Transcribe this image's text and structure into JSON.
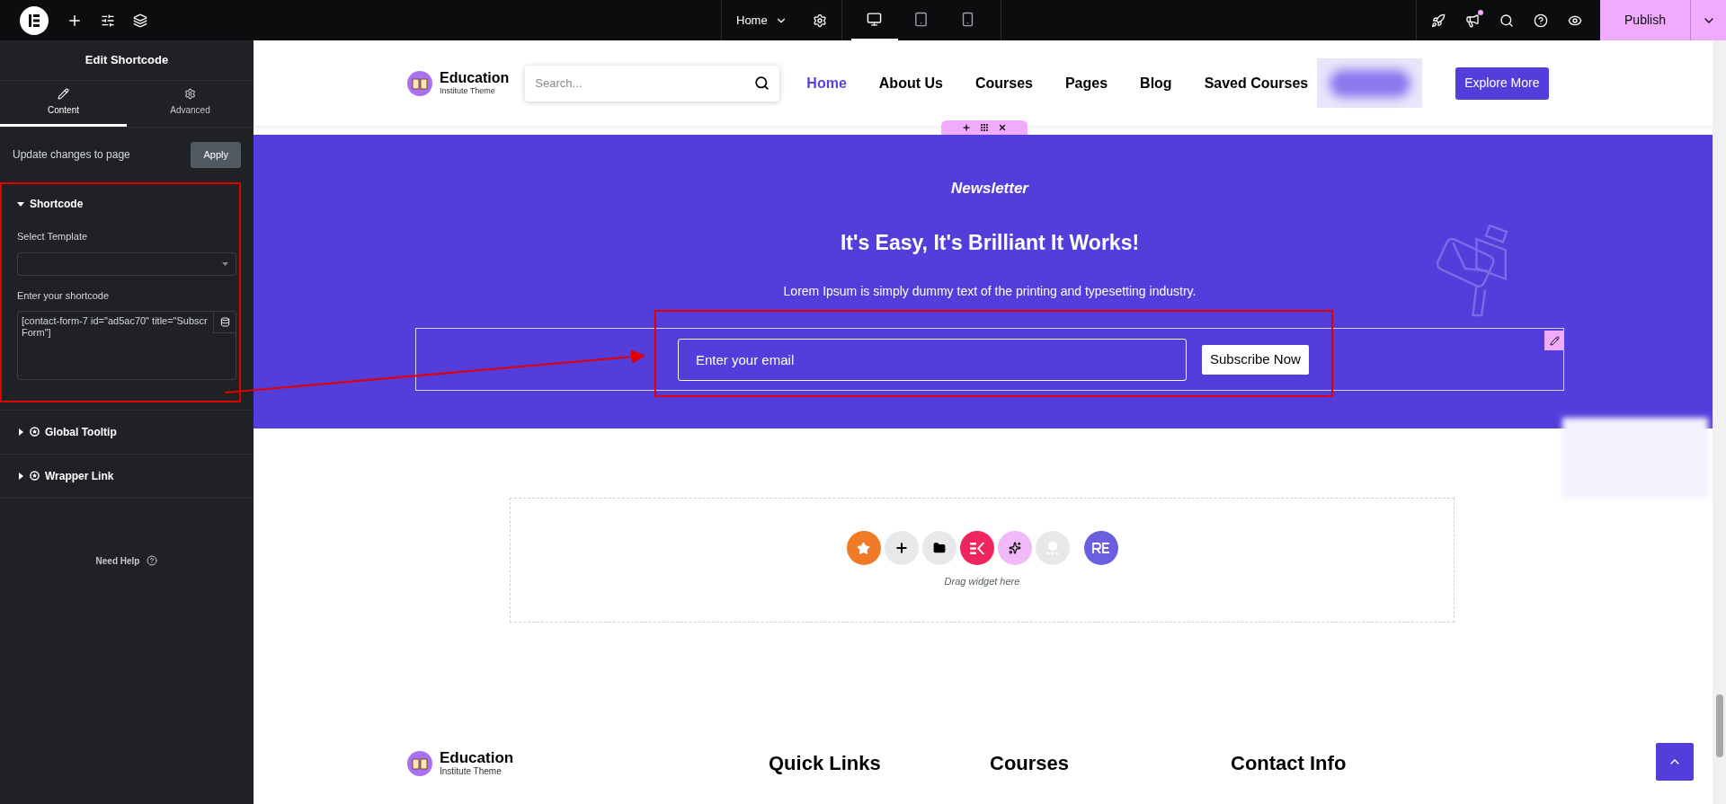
{
  "topbar": {
    "page_title": "Home",
    "devices": [
      {
        "kind": "desktop",
        "selected": true
      },
      {
        "kind": "tablet",
        "selected": false
      },
      {
        "kind": "mobile",
        "selected": false
      }
    ],
    "publish": "Publish"
  },
  "panel": {
    "title": "Edit Shortcode",
    "tabs": [
      {
        "label": "Content",
        "kind": "content",
        "selected": true
      },
      {
        "label": "Advanced",
        "kind": "advanced",
        "selected": false
      }
    ],
    "update_text": "Update changes to page",
    "apply": "Apply",
    "sections": [
      {
        "title": "Shortcode",
        "kind": "plain",
        "expanded": true,
        "select_label": "Select Template",
        "shortcode_label": "Enter your shortcode",
        "shortcode_value": "[contact-form-7 id=\"ad5ac70\" title=\"Subscr\nForm\"]"
      },
      {
        "title": "Global Tooltip",
        "kind": "addon",
        "expanded": false
      },
      {
        "title": "Wrapper Link",
        "kind": "addon",
        "expanded": false
      }
    ],
    "need_help": "Need Help"
  },
  "site_header": {
    "logo_title": "Education",
    "logo_subtitle": "Institute Theme",
    "search_placeholder": "Search...",
    "nav": [
      {
        "label": "Home",
        "selected": true
      },
      {
        "label": "About Us",
        "selected": false
      },
      {
        "label": "Courses",
        "selected": false
      },
      {
        "label": "Pages",
        "selected": false
      },
      {
        "label": "Blog",
        "selected": false
      },
      {
        "label": "Saved Courses",
        "selected": false
      }
    ],
    "cta": "Explore More"
  },
  "newsletter": {
    "eyebrow": "Newsletter",
    "heading": "It's Easy, It's Brilliant It Works!",
    "text": "Lorem Ipsum is simply dummy text of the printing and typesetting industry.",
    "email_placeholder": "Enter your email",
    "button": "Subscribe Now"
  },
  "drop_zone": {
    "hint": "Drag widget here"
  },
  "footer": {
    "logo_title": "Education",
    "logo_subtitle": "Institute Theme",
    "columns": [
      "Quick Links",
      "Courses",
      "Contact Info"
    ]
  }
}
